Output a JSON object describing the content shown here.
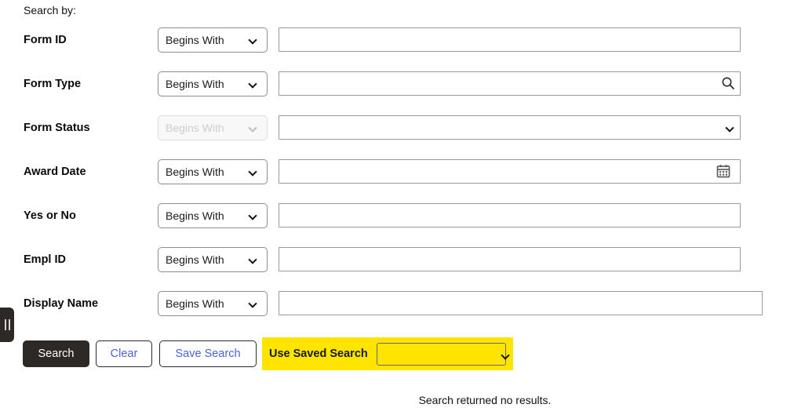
{
  "page": {
    "search_by_label": "Search by:",
    "status_message": "Search returned no results."
  },
  "collapse_handle": {
    "name": "collapse-panel-handle"
  },
  "criteria": {
    "operator_options": [
      "Begins With"
    ],
    "rows": [
      {
        "label": "Form ID",
        "operator": "Begins With",
        "operator_disabled": false,
        "value_control": "text",
        "value": "",
        "icon": null
      },
      {
        "label": "Form Type",
        "operator": "Begins With",
        "operator_disabled": false,
        "value_control": "text",
        "value": "",
        "icon": "search-icon"
      },
      {
        "label": "Form Status",
        "operator": "Begins With",
        "operator_disabled": true,
        "value_control": "select",
        "value": "",
        "icon": null
      },
      {
        "label": "Award Date",
        "operator": "Begins With",
        "operator_disabled": false,
        "value_control": "text",
        "value": "",
        "icon": "calendar-icon"
      },
      {
        "label": "Yes or No",
        "operator": "Begins With",
        "operator_disabled": false,
        "value_control": "text",
        "value": "",
        "icon": null
      },
      {
        "label": "Empl ID",
        "operator": "Begins With",
        "operator_disabled": false,
        "value_control": "text",
        "value": "",
        "icon": null
      },
      {
        "label": "Display Name",
        "operator": "Begins With",
        "operator_disabled": false,
        "value_control": "text-wide",
        "value": "",
        "icon": null
      }
    ]
  },
  "actions": {
    "search_label": "Search",
    "clear_label": "Clear",
    "save_search_label": "Save Search",
    "use_saved_search_label": "Use Saved Search",
    "saved_search_value": "",
    "saved_search_options": [
      ""
    ]
  },
  "colors": {
    "primary_button_bg": "#2d2926",
    "secondary_button_text": "#4a63d8",
    "highlight": "#ffe400",
    "field_border": "#9a9a9a",
    "disabled_text": "#b9b9b9"
  }
}
